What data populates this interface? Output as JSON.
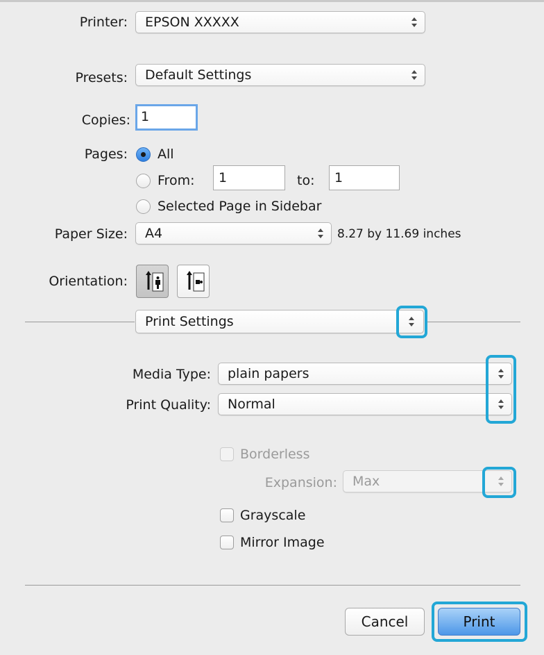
{
  "printer": {
    "label": "Printer:",
    "value": "EPSON XXXXX"
  },
  "presets": {
    "label": "Presets:",
    "value": "Default Settings"
  },
  "copies": {
    "label": "Copies:",
    "value": "1"
  },
  "pages": {
    "label": "Pages:",
    "all_label": "All",
    "from_label": "From:",
    "from_value": "1",
    "to_label": "to:",
    "to_value": "1",
    "selected_label": "Selected Page in Sidebar",
    "selected": "All"
  },
  "paper_size": {
    "label": "Paper Size:",
    "value": "A4",
    "dimensions": "8.27 by 11.69 inches"
  },
  "orientation": {
    "label": "Orientation:",
    "selected": "portrait"
  },
  "section_popup": {
    "value": "Print Settings"
  },
  "media_type": {
    "label": "Media Type:",
    "value": "plain papers"
  },
  "print_quality": {
    "label": "Print Quality:",
    "value": "Normal"
  },
  "borderless": {
    "label": "Borderless",
    "checked": false,
    "enabled": false
  },
  "expansion": {
    "label": "Expansion:",
    "value": "Max",
    "enabled": false
  },
  "grayscale": {
    "label": "Grayscale",
    "checked": false
  },
  "mirror_image": {
    "label": "Mirror Image",
    "checked": false
  },
  "buttons": {
    "cancel": "Cancel",
    "print": "Print"
  },
  "colors": {
    "highlight": "#23a7d6",
    "default_button": "#4d97e8",
    "focus_ring": "#6aa6e8"
  },
  "icons": [
    "updown-arrows-icon",
    "portrait-orientation-icon",
    "landscape-orientation-icon",
    "radio-selected-icon",
    "radio-unselected-icon",
    "checkbox-icon"
  ]
}
